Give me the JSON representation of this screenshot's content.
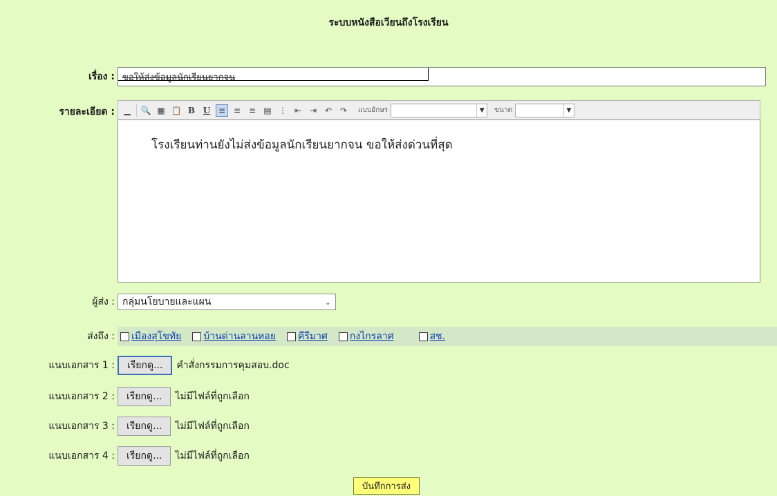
{
  "page": {
    "title": "ระบบหนังสือเวียนถึงโรงเรียน"
  },
  "subject": {
    "label": "เรื่อง :",
    "value": "ขอให้ส่งข้อมูลนักเรียนยากจน"
  },
  "details": {
    "label": "รายละเอียด :",
    "toolbar": {
      "font_label": "แบบอักษร",
      "size_label": "ขนาด"
    },
    "content": "โรงเรียนท่านยังไม่ส่งข้อมูลนักเรียนยากจน ขอให้ส่งด่วนที่สุด"
  },
  "sender": {
    "label": "ผู้ส่ง :",
    "value": "กลุ่มนโยบายและแผน"
  },
  "recipients": {
    "label": "ส่งถึง :",
    "items": [
      "เมืองสุโขทัย",
      "บ้านด่านลานหอย",
      "คีรีมาศ",
      "กงไกรลาศ",
      "สช."
    ]
  },
  "attachments": [
    {
      "label": "แนบเอกสาร 1 :",
      "button": "เรียกดู...",
      "file": "คำสั่งกรรมการคุมสอบ.doc"
    },
    {
      "label": "แนบเอกสาร 2 :",
      "button": "เรียกดู...",
      "file": "ไม่มีไฟล์ที่ถูกเลือก"
    },
    {
      "label": "แนบเอกสาร 3 :",
      "button": "เรียกดู...",
      "file": "ไม่มีไฟล์ที่ถูกเลือก"
    },
    {
      "label": "แนบเอกสาร 4 :",
      "button": "เรียกดู...",
      "file": "ไม่มีไฟล์ที่ถูกเลือก"
    }
  ],
  "submit": {
    "label": "บันทึกการส่ง"
  },
  "icons": {
    "toolbar": [
      "preview-icon",
      "table-grid-icon",
      "paste-icon",
      "bold-icon",
      "underline-icon",
      "align-left-icon",
      "align-center-icon",
      "align-right-icon",
      "insert-table-icon",
      "ordered-list-icon",
      "outdent-icon",
      "indent-icon",
      "undo-icon",
      "redo-icon"
    ],
    "dropdown": "chevron-down-icon"
  },
  "colors": {
    "background": "#e4fbc4",
    "recipient_strip": "#d4e8c7",
    "link": "#0b3fb0",
    "submit_button": "#ffff7a"
  }
}
